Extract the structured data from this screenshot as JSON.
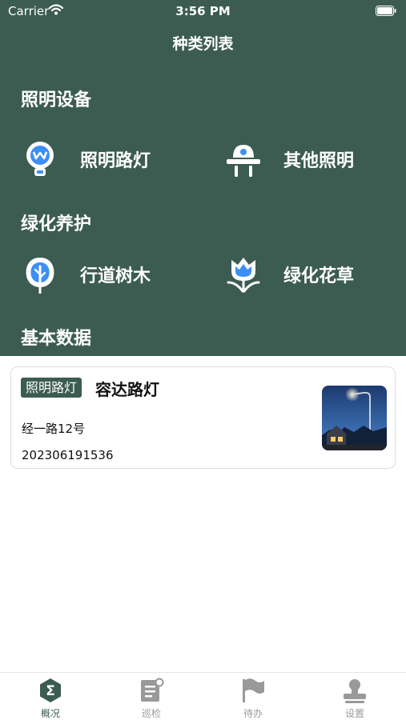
{
  "status_bar": {
    "carrier": "Carrier",
    "time": "3:56 PM"
  },
  "nav": {
    "title": "种类列表"
  },
  "sections": [
    {
      "title": "照明设备",
      "items": [
        {
          "label": "照明路灯",
          "icon": "street-lamp-icon"
        },
        {
          "label": "其他照明",
          "icon": "other-light-icon"
        }
      ]
    },
    {
      "title": "绿化养护",
      "items": [
        {
          "label": "行道树木",
          "icon": "tree-icon"
        },
        {
          "label": "绿化花草",
          "icon": "flower-icon"
        }
      ]
    },
    {
      "title": "基本数据"
    }
  ],
  "card": {
    "tag": "照明路灯",
    "title": "容达路灯",
    "address": "经一路12号",
    "code": "202306191536"
  },
  "tabs": [
    {
      "label": "概况",
      "icon": "sigma-icon",
      "active": true
    },
    {
      "label": "巡检",
      "icon": "checklist-icon",
      "active": false
    },
    {
      "label": "待办",
      "icon": "flag-icon",
      "active": false
    },
    {
      "label": "设置",
      "icon": "stamp-icon",
      "active": false
    }
  ],
  "colors": {
    "primary": "#3c5c51",
    "icon_blue": "#3d8ff5",
    "tab_inactive": "#999999",
    "white": "#ffffff"
  }
}
